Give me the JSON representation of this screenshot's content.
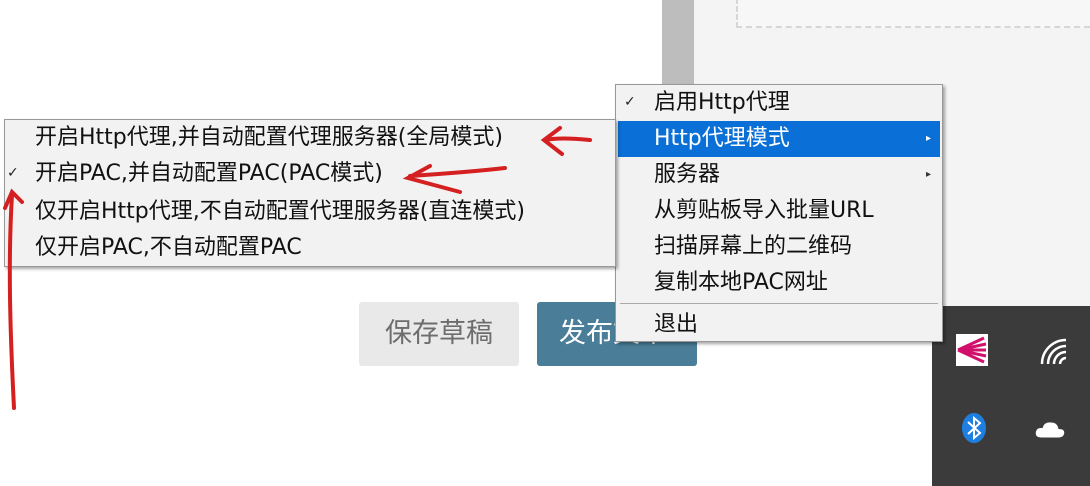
{
  "editor": {
    "save_draft_label": "保存草稿",
    "publish_label": "发布文章"
  },
  "tray_menu": {
    "items": [
      {
        "label": "启用Http代理",
        "checked": true
      },
      {
        "label": "Http代理模式",
        "highlighted": true,
        "has_submenu": true
      },
      {
        "label": "服务器",
        "has_submenu": true
      },
      {
        "label": "从剪贴板导入批量URL"
      },
      {
        "label": "扫描屏幕上的二维码"
      },
      {
        "label": "复制本地PAC网址"
      },
      {
        "label": "退出"
      }
    ]
  },
  "proxy_mode_submenu": {
    "items": [
      {
        "label": "开启Http代理,并自动配置代理服务器(全局模式)"
      },
      {
        "label": "开启PAC,并自动配置PAC(PAC模式)",
        "checked": true
      },
      {
        "label": "仅开启Http代理,不自动配置代理服务器(直连模式)"
      },
      {
        "label": "仅开启PAC,不自动配置PAC"
      }
    ]
  },
  "taskbar": {
    "icons": [
      "app-tray-icon",
      "wifi-icon",
      "bluetooth-icon",
      "onedrive-cloud-icon"
    ]
  },
  "colors": {
    "highlight": "#0a6fd6",
    "publish_button": "#4a7d97",
    "annotation": "#d42020",
    "taskbar": "#3b3b3b"
  }
}
